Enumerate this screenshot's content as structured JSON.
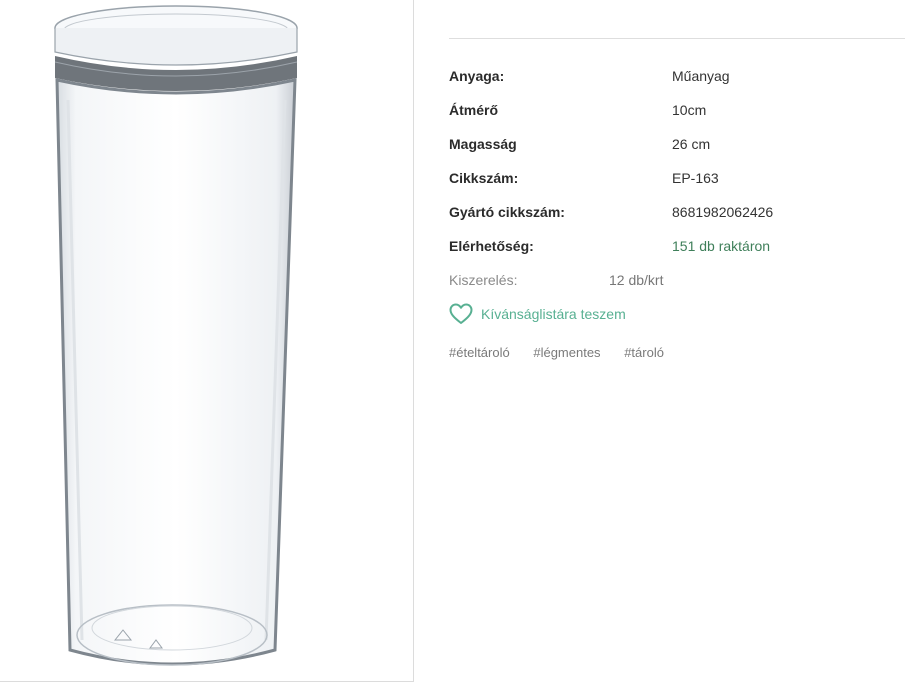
{
  "specs": [
    {
      "label": "Anyaga:",
      "value": "Műanyag"
    },
    {
      "label": "Átmérő",
      "value": "10cm"
    },
    {
      "label": "Magasság",
      "value": "26 cm"
    },
    {
      "label": "Cikkszám:",
      "value": "EP-163"
    },
    {
      "label": "Gyártó cikkszám:",
      "value": "8681982062426"
    },
    {
      "label": "Elérhetőség:",
      "value": "151 db raktáron"
    }
  ],
  "packaging": {
    "label": "Kiszerelés:",
    "value": "12 db/krt"
  },
  "wishlist": {
    "label": "Kívánságlistára teszem",
    "icon": "heart-icon",
    "color": "#58b092"
  },
  "tags": [
    "#ételtároló",
    "#légmentes",
    "#tároló"
  ],
  "colors": {
    "availability": "#3f7f5a",
    "accent": "#58b092"
  }
}
